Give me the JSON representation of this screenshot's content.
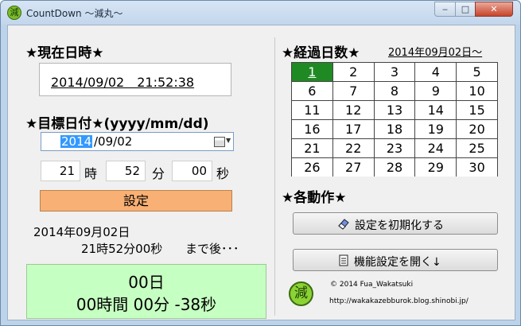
{
  "window": {
    "app_icon_char": "減",
    "title": "CountDown ～減丸～",
    "controls": {
      "minimize": "‒",
      "maximize": "□",
      "close": "✕"
    }
  },
  "current": {
    "heading": "★現在日時★",
    "datetime": "2014/09/02　21:52:38"
  },
  "target": {
    "heading": "★目標日付★(yyyy/mm/dd)",
    "date_selected_part": "2014",
    "date_rest": "/09/02",
    "hour_value": "21",
    "hour_unit": "時",
    "minute_value": "52",
    "minute_unit": "分",
    "second_value": "00",
    "second_unit": "秒",
    "set_button": "設定",
    "result_date": "2014年09月02日",
    "result_time": "21時52分00秒",
    "remaining_label": "まで後･･･"
  },
  "countdown": {
    "days": "00日",
    "hms": "00時間 00分 -38秒",
    "background": "#c6ffc2"
  },
  "elapsed": {
    "heading": "★経過日数★",
    "since_label": "2014年09月02日～",
    "days": [
      "1",
      "2",
      "3",
      "4",
      "5",
      "6",
      "7",
      "8",
      "9",
      "10",
      "11",
      "12",
      "13",
      "14",
      "15",
      "16",
      "17",
      "18",
      "19",
      "20",
      "21",
      "22",
      "23",
      "24",
      "25",
      "26",
      "27",
      "28",
      "29",
      "30"
    ],
    "active_day": "1",
    "active_color": "#1f8a23"
  },
  "actions": {
    "heading": "★各動作★",
    "reset_button": "設定を初期化する",
    "reset_icon": "eraser-icon",
    "settings_button": "機能設定を開く↓",
    "settings_icon": "document-icon"
  },
  "footer": {
    "stamp_char": "減",
    "copyright": "© 2014 Fua_Wakatsuki",
    "url": "http://wakakazebburok.blog.shinobi.jp/"
  },
  "colors": {
    "set_button": "#f9b074",
    "stamp": "#8bd234"
  }
}
